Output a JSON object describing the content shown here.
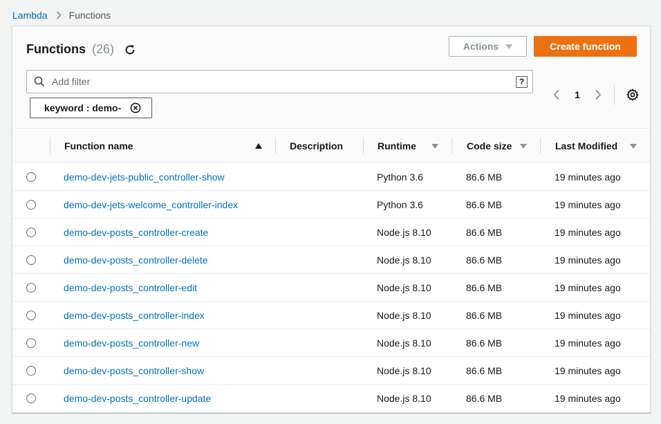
{
  "breadcrumb": {
    "root": "Lambda",
    "current": "Functions"
  },
  "header": {
    "title": "Functions",
    "count": "(26)",
    "actions_label": "Actions",
    "create_label": "Create function"
  },
  "filter": {
    "placeholder": "Add filter",
    "help": "?",
    "token": "keyword : demo-"
  },
  "pagination": {
    "page": "1"
  },
  "table": {
    "columns": [
      "Function name",
      "Description",
      "Runtime",
      "Code size",
      "Last Modified"
    ],
    "rows": [
      {
        "name": "demo-dev-jets-public_controller-show",
        "runtime": "Python 3.6",
        "size": "86.6 MB",
        "modified": "19 minutes ago"
      },
      {
        "name": "demo-dev-jets-welcome_controller-index",
        "runtime": "Python 3.6",
        "size": "86.6 MB",
        "modified": "19 minutes ago"
      },
      {
        "name": "demo-dev-posts_controller-create",
        "runtime": "Node.js 8.10",
        "size": "86.6 MB",
        "modified": "19 minutes ago"
      },
      {
        "name": "demo-dev-posts_controller-delete",
        "runtime": "Node.js 8.10",
        "size": "86.6 MB",
        "modified": "19 minutes ago"
      },
      {
        "name": "demo-dev-posts_controller-edit",
        "runtime": "Node.js 8.10",
        "size": "86.6 MB",
        "modified": "19 minutes ago"
      },
      {
        "name": "demo-dev-posts_controller-index",
        "runtime": "Node.js 8.10",
        "size": "86.6 MB",
        "modified": "19 minutes ago"
      },
      {
        "name": "demo-dev-posts_controller-new",
        "runtime": "Node.js 8.10",
        "size": "86.6 MB",
        "modified": "19 minutes ago"
      },
      {
        "name": "demo-dev-posts_controller-show",
        "runtime": "Node.js 8.10",
        "size": "86.6 MB",
        "modified": "19 minutes ago"
      },
      {
        "name": "demo-dev-posts_controller-update",
        "runtime": "Node.js 8.10",
        "size": "86.6 MB",
        "modified": "19 minutes ago"
      }
    ]
  },
  "colors": {
    "link": "#0073bb",
    "primary": "#ec7211",
    "muted": "#879596"
  }
}
